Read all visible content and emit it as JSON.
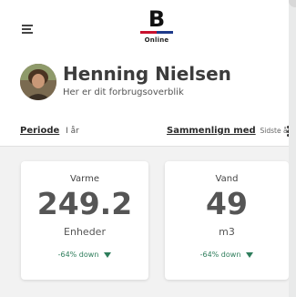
{
  "header": {
    "logo_letter": "B",
    "logo_sub": "Online",
    "brand_colors": {
      "red": "#c8102e",
      "blue": "#1e3a8a"
    },
    "menu_icon": "hamburger-icon"
  },
  "profile": {
    "name": "Henning Nielsen",
    "subtitle": "Her er dit forbrugsoverblik"
  },
  "filters": {
    "period_label": "Periode",
    "period_value": "I år",
    "compare_label": "Sammenlign med",
    "compare_value": "Sidste år",
    "more_icon": "kebab-menu-icon"
  },
  "cards": [
    {
      "title": "Varme",
      "value": "249.2",
      "unit": "Enheder",
      "trend": "-64% down"
    },
    {
      "title": "Vand",
      "value": "49",
      "unit": "m3",
      "trend": "-64% down"
    }
  ],
  "colors": {
    "trend_down": "#2e7d5b"
  }
}
